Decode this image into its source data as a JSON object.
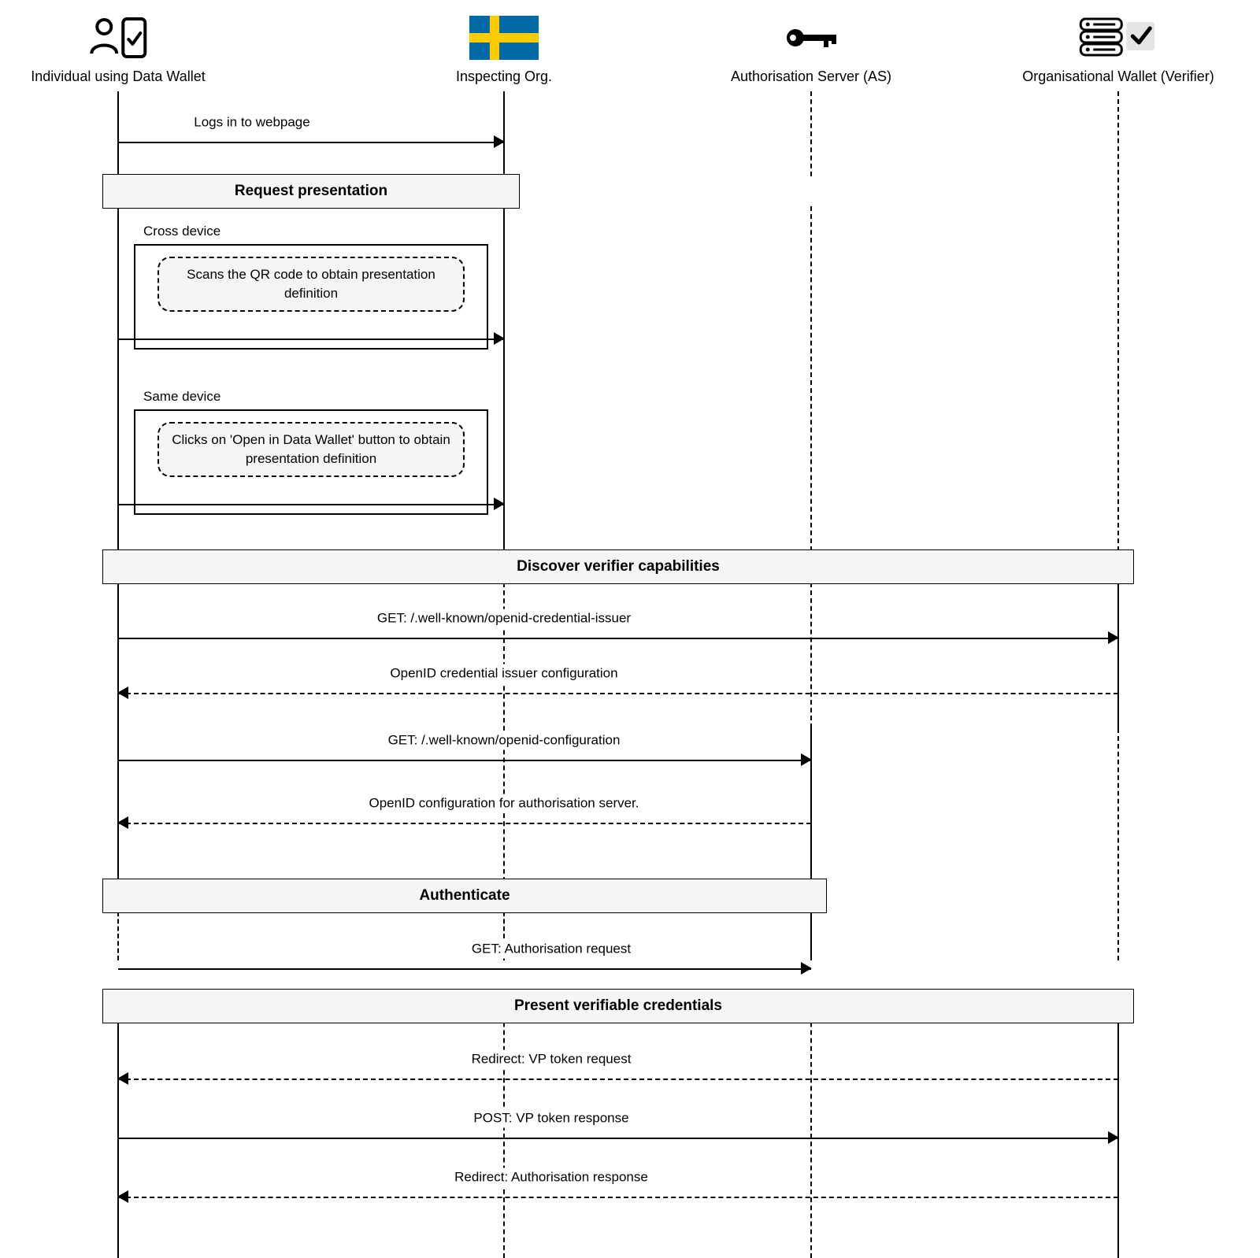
{
  "actors": {
    "individual": "Individual using Data Wallet",
    "inspecting": "Inspecting Org.",
    "as": "Authorisation Server (AS)",
    "verifier": "Organisational Wallet (Verifier)"
  },
  "sections": {
    "request_presentation": "Request presentation",
    "discover": "Discover verifier capabilities",
    "authenticate": "Authenticate",
    "present": "Present verifiable credentials"
  },
  "alts": {
    "cross_device": "Cross device",
    "same_device": "Same device"
  },
  "notes": {
    "scan_qr": "Scans the QR code to obtain presentation definition",
    "click_open": "Clicks on 'Open in Data Wallet' button to obtain presentation definition"
  },
  "msgs": {
    "login": "Logs in to webpage",
    "get_issuer": "GET: /.well-known/openid-credential-issuer",
    "issuer_config": "OpenID credential issuer configuration",
    "get_openid": "GET: /.well-known/openid-configuration",
    "openid_config": "OpenID configuration for authorisation server.",
    "auth_request": "GET: Authorisation request",
    "vp_request": "Redirect: VP token request",
    "vp_response": "POST: VP token response",
    "auth_response": "Redirect: Authorisation response"
  }
}
